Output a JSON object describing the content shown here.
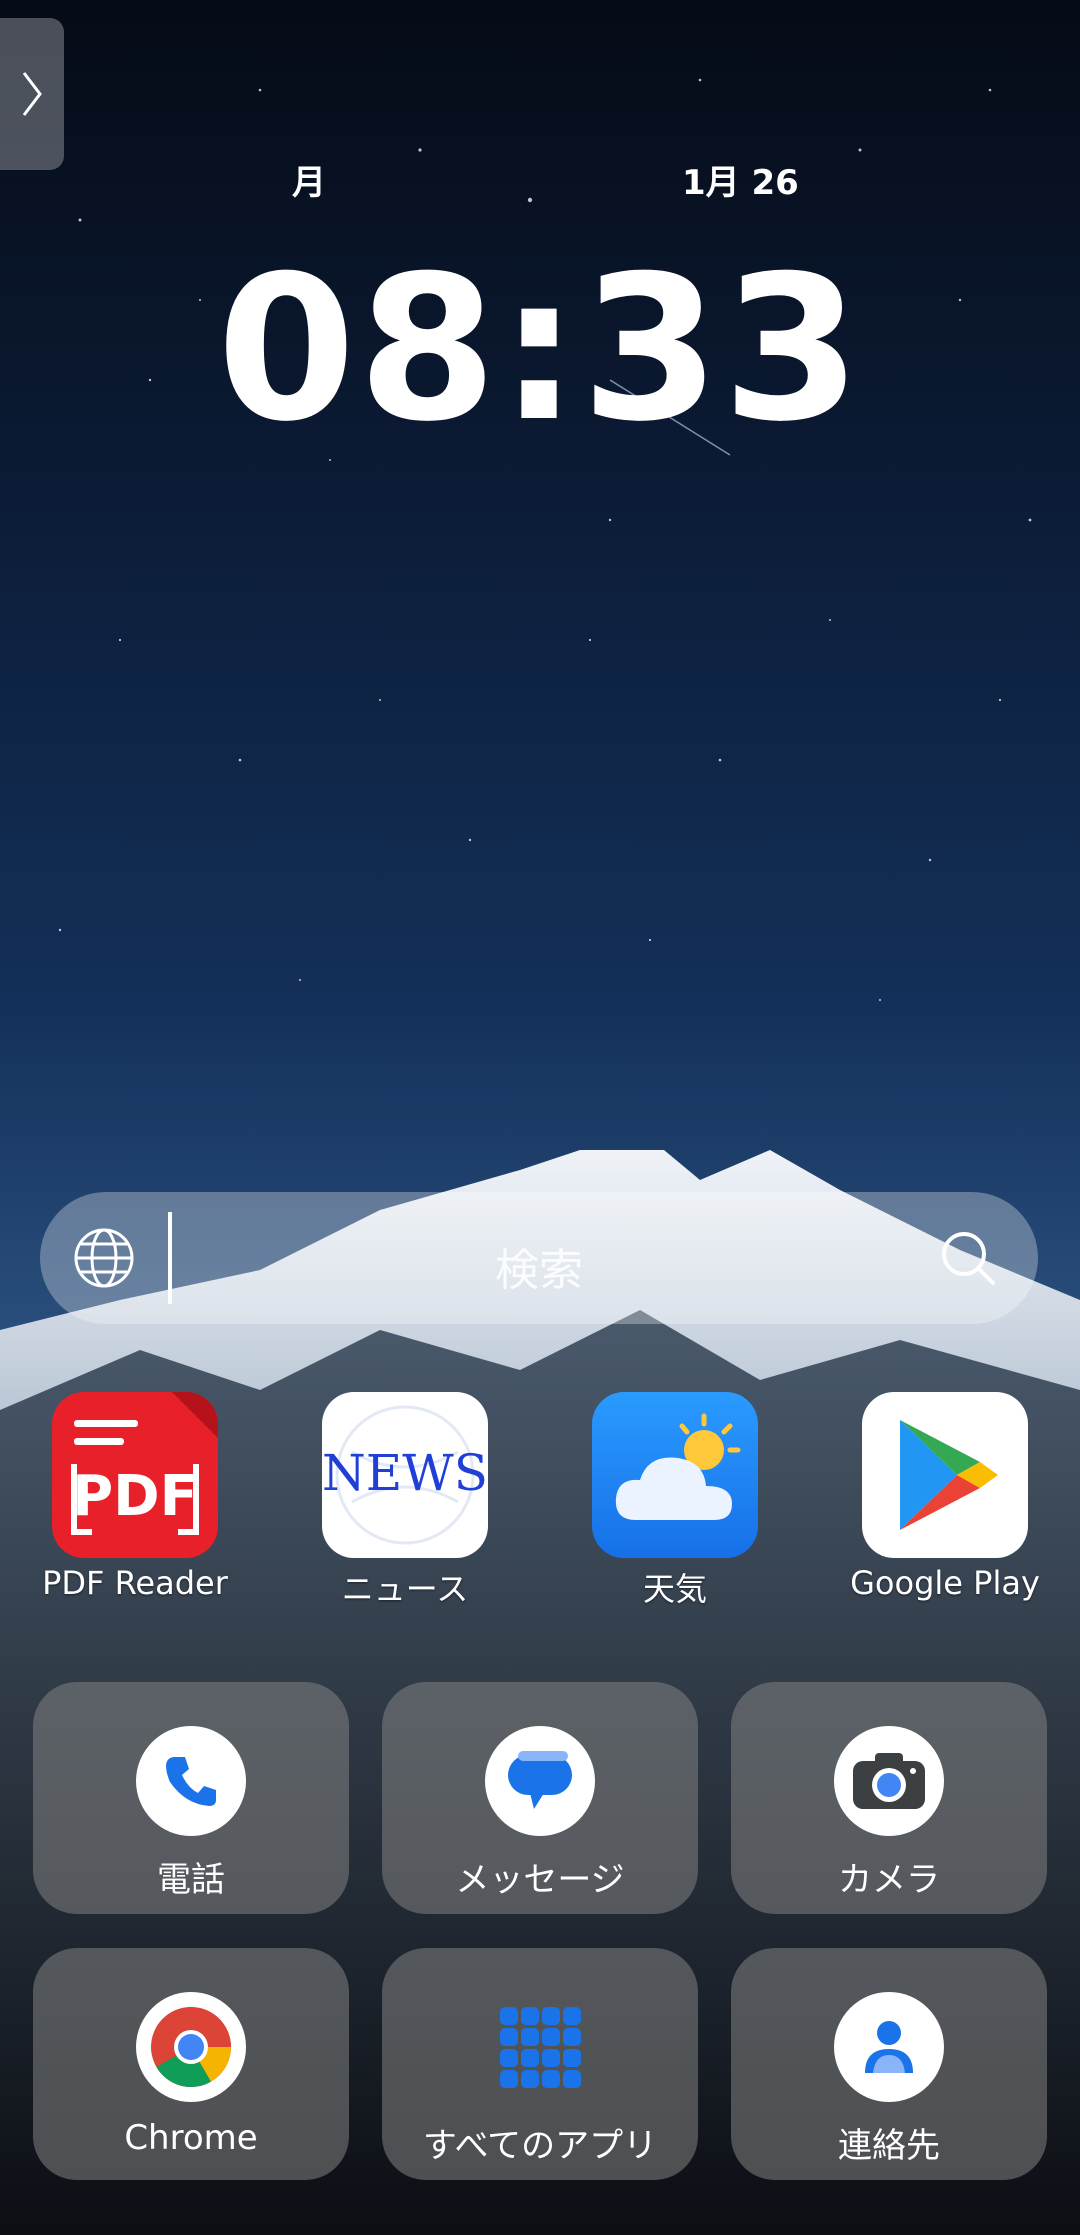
{
  "status": {
    "day": "月",
    "date": "1月 26",
    "time": "08:33"
  },
  "search": {
    "placeholder": "検索"
  },
  "apps": [
    {
      "label": "PDF Reader",
      "icon": "pdf-reader-icon",
      "icon_text": "PDF"
    },
    {
      "label": "ニュース",
      "icon": "news-icon",
      "icon_text": "NEWS"
    },
    {
      "label": "天気",
      "icon": "weather-icon"
    },
    {
      "label": "Google Play",
      "icon": "google-play-icon"
    }
  ],
  "tiles": [
    {
      "label": "電話",
      "icon": "phone-icon"
    },
    {
      "label": "メッセージ",
      "icon": "messages-icon"
    },
    {
      "label": "カメラ",
      "icon": "camera-icon"
    },
    {
      "label": "Chrome",
      "icon": "chrome-icon"
    },
    {
      "label": "すべてのアプリ",
      "icon": "all-apps-grid-icon"
    },
    {
      "label": "連絡先",
      "icon": "contacts-icon"
    }
  ],
  "colors": {
    "accent_blue": "#1a73e8",
    "pdf_red": "#e8202a",
    "weather_blue": "#1f8fff",
    "tile_bg": "rgba(130,130,130,0.55)"
  }
}
